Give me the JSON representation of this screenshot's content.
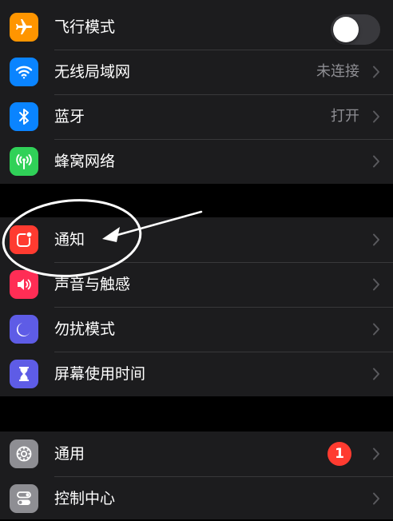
{
  "group1": {
    "rows": [
      {
        "label": "飞行模式",
        "icon": "airplane-icon",
        "icon_color": "#ff9500",
        "toggle_on": false
      },
      {
        "label": "无线局域网",
        "icon": "wifi-icon",
        "icon_color": "#0a84ff",
        "value": "未连接"
      },
      {
        "label": "蓝牙",
        "icon": "bluetooth-icon",
        "icon_color": "#0a84ff",
        "value": "打开"
      },
      {
        "label": "蜂窝网络",
        "icon": "antenna-icon",
        "icon_color": "#30d158"
      }
    ]
  },
  "group2": {
    "rows": [
      {
        "label": "通知",
        "icon": "notification-icon",
        "icon_color": "#ff3b30"
      },
      {
        "label": "声音与触感",
        "icon": "speaker-icon",
        "icon_color": "#ff2d55"
      },
      {
        "label": "勿扰模式",
        "icon": "moon-icon",
        "icon_color": "#5e5ce6"
      },
      {
        "label": "屏幕使用时间",
        "icon": "hourglass-icon",
        "icon_color": "#5e5ce6"
      }
    ]
  },
  "group3": {
    "rows": [
      {
        "label": "通用",
        "icon": "gear-icon",
        "icon_color": "#8e8e93",
        "badge": "1"
      },
      {
        "label": "控制中心",
        "icon": "switches-icon",
        "icon_color": "#8e8e93"
      }
    ]
  },
  "colors": {
    "background": "#000000",
    "cell": "#1c1c1e",
    "separator": "#38383a",
    "secondary_text": "#8e8e93",
    "annotation": "#ffffff"
  }
}
